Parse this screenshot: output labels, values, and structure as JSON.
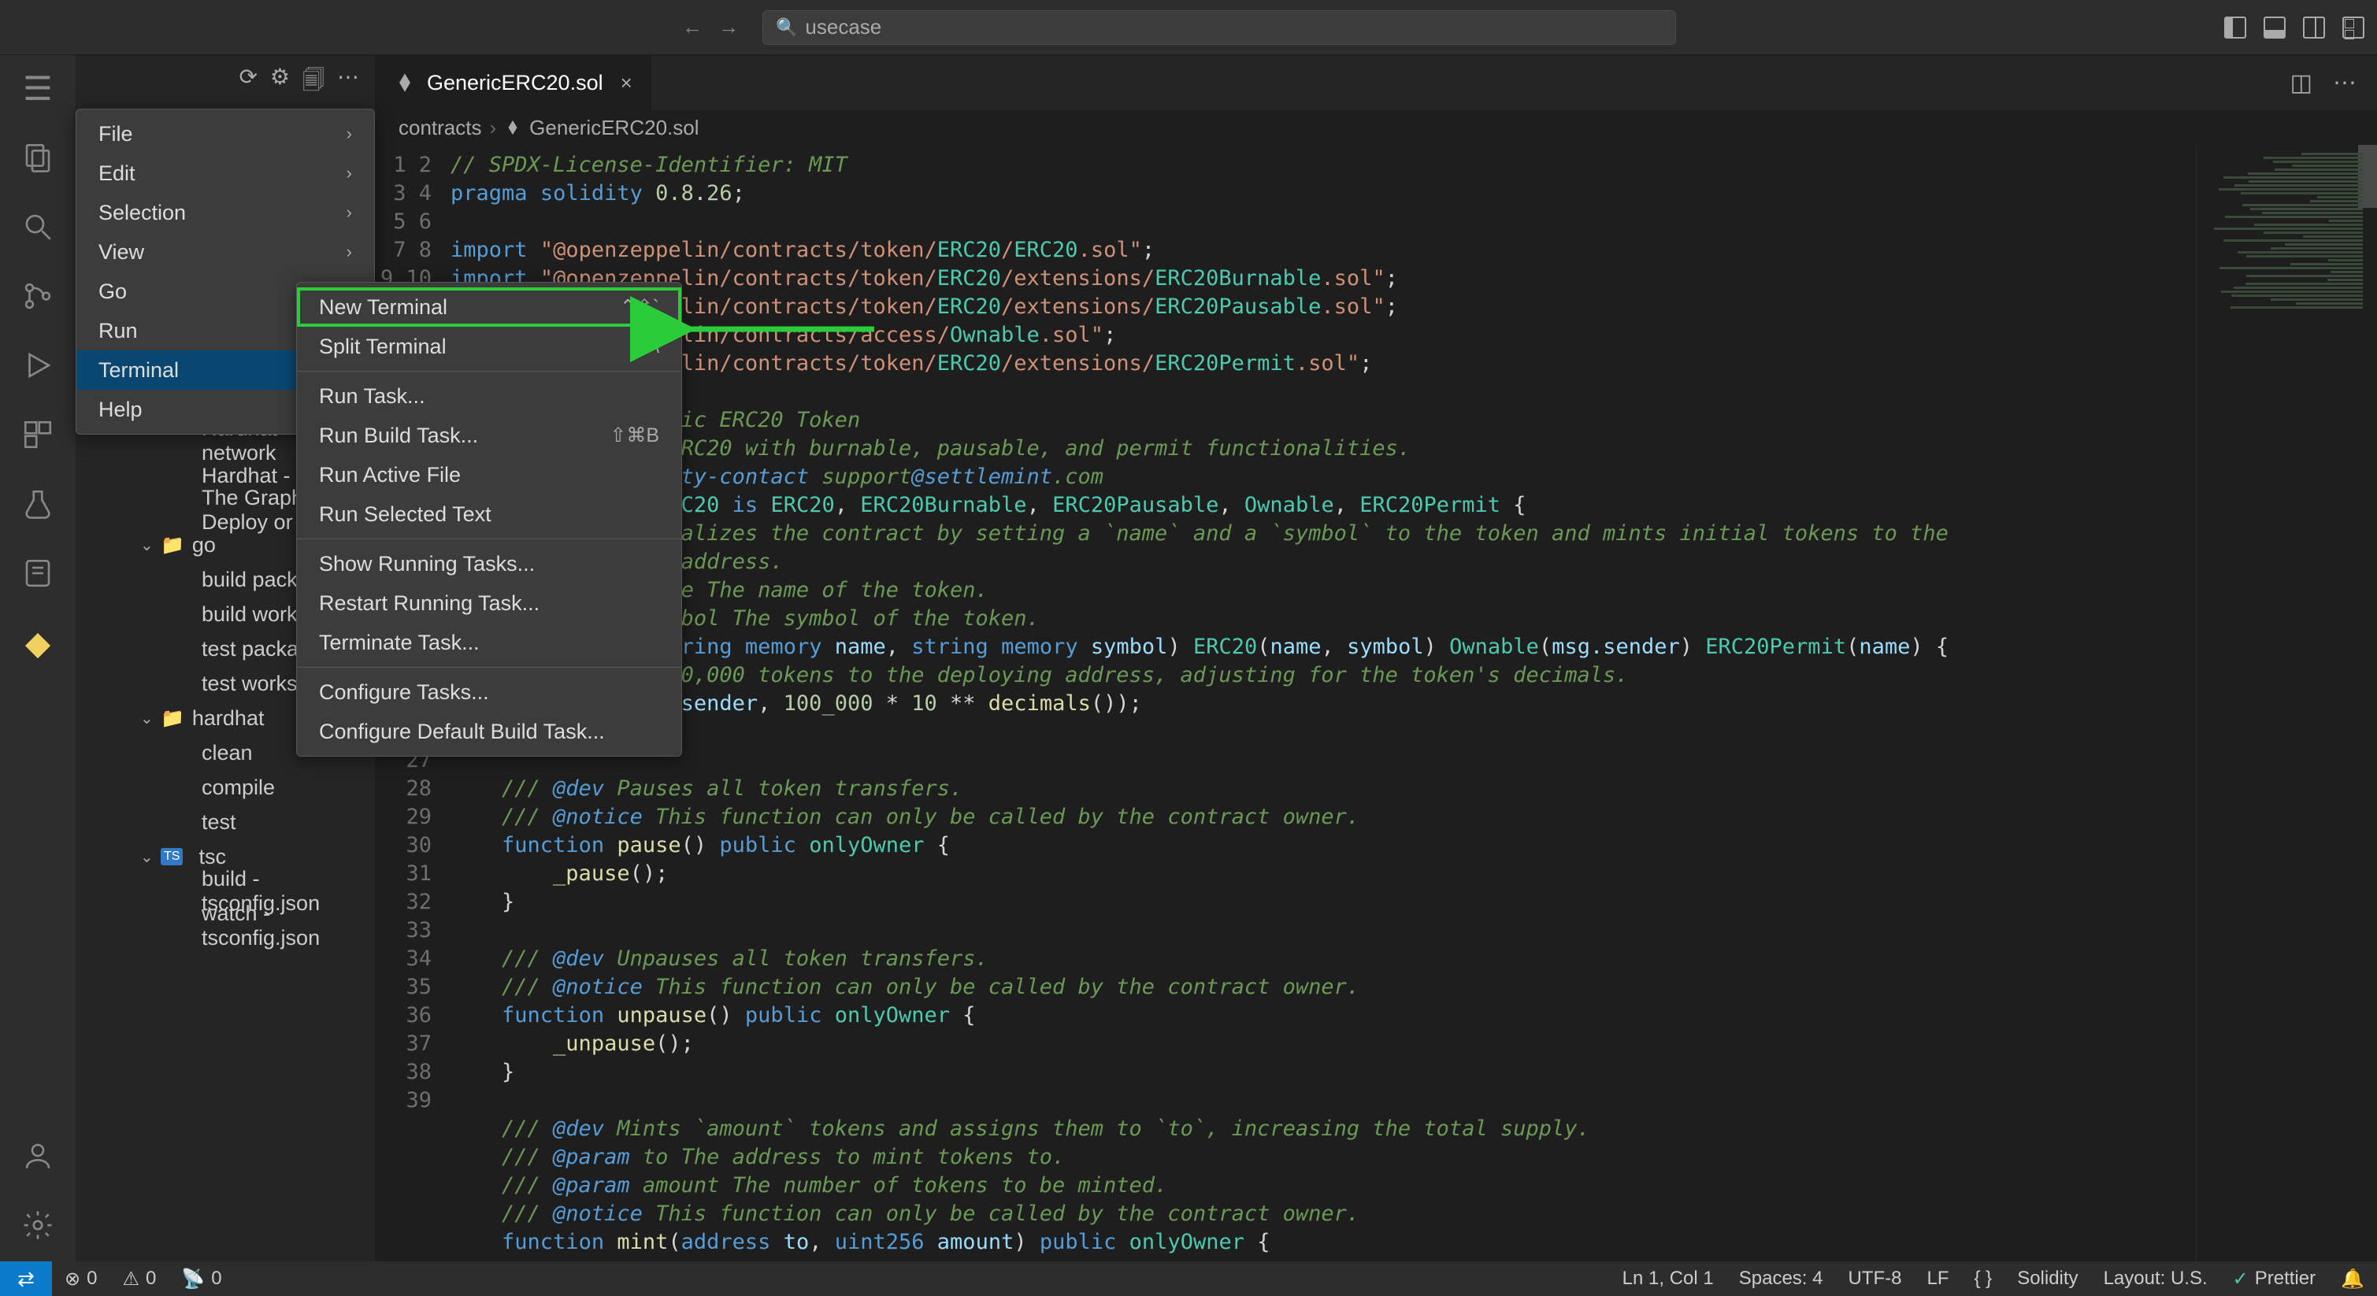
{
  "titlebar": {
    "search_text": "usecase"
  },
  "menu": {
    "items": [
      {
        "label": "File"
      },
      {
        "label": "Edit"
      },
      {
        "label": "Selection"
      },
      {
        "label": "View"
      },
      {
        "label": "Go"
      },
      {
        "label": "Run"
      },
      {
        "label": "Terminal"
      },
      {
        "label": "Help"
      }
    ]
  },
  "submenu": {
    "items": [
      {
        "label": "New Terminal",
        "shortcut": "⌃⇧`",
        "highlighted": true
      },
      {
        "label": "Split Terminal",
        "shortcut": "⌘\\"
      },
      {
        "sep": true
      },
      {
        "label": "Run Task..."
      },
      {
        "label": "Run Build Task...",
        "shortcut": "⇧⌘B"
      },
      {
        "label": "Run Active File"
      },
      {
        "label": "Run Selected Text"
      },
      {
        "sep": true
      },
      {
        "label": "Show Running Tasks..."
      },
      {
        "label": "Restart Running Task..."
      },
      {
        "label": "Terminate Task..."
      },
      {
        "sep": true
      },
      {
        "label": "Configure Tasks..."
      },
      {
        "label": "Configure Default Build Task..."
      }
    ]
  },
  "sidebar_tree": {
    "visible_partial": [
      {
        "label": "Hardhat - Start network",
        "type": "task"
      },
      {
        "label": "Hardhat - Test",
        "type": "task"
      },
      {
        "label": "The Graph - Deploy or u…",
        "type": "task"
      }
    ],
    "groups": [
      {
        "name": "go",
        "children": [
          {
            "label": "build package"
          },
          {
            "label": "build workspace"
          },
          {
            "label": "test package"
          },
          {
            "label": "test workspace"
          }
        ]
      },
      {
        "name": "hardhat",
        "children": [
          {
            "label": "clean"
          },
          {
            "label": "compile"
          },
          {
            "label": "test"
          }
        ]
      },
      {
        "name": "tsc",
        "icon": "ts",
        "children": [
          {
            "label": "build - tsconfig.json"
          },
          {
            "label": "watch - tsconfig.json"
          }
        ]
      }
    ]
  },
  "editor": {
    "tab_label": "GenericERC20.sol",
    "breadcrumb": [
      "contracts",
      "GenericERC20.sol"
    ],
    "code_lines": [
      "// SPDX-License-Identifier: MIT",
      "pragma solidity 0.8.26;",
      "",
      "import \"@openzeppelin/contracts/token/ERC20/ERC20.sol\";",
      "import \"@openzeppelin/contracts/token/ERC20/extensions/ERC20Burnable.sol\";",
      "import \"@openzeppelin/contracts/token/ERC20/extensions/ERC20Pausable.sol\";",
      "import \"@openzeppelin/contracts/access/Ownable.sol\";",
      "import \"@openzeppelin/contracts/token/ERC20/extensions/ERC20Permit.sol\";",
      "",
      "/// @title A generic ERC20 Token",
      "/// @dev Extends ERC20 with burnable, pausable, and permit functionalities.",
      "/// @custom:security-contact support@settlemint.com",
      "contract GenericERC20 is ERC20, ERC20Burnable, ERC20Pausable, Ownable, ERC20Permit {",
      "    /// @dev Initializes the contract by setting a `name` and a `symbol` to the token and mints initial tokens to the",
      "    /// deploying address.",
      "    /// @param name The name of the token.",
      "    /// @param symbol The symbol of the token.",
      "    constructor(string memory name, string memory symbol) ERC20(name, symbol) Ownable(msg.sender) ERC20Permit(name) {",
      "        // Mint 100,000 tokens to the deploying address, adjusting for the token's decimals.",
      "        _mint(msg.sender, 100_000 * 10 ** decimals());",
      "    }",
      "",
      "    /// @dev Pauses all token transfers.",
      "    /// @notice This function can only be called by the contract owner.",
      "    function pause() public onlyOwner {",
      "        _pause();",
      "    }",
      "",
      "    /// @dev Unpauses all token transfers.",
      "    /// @notice This function can only be called by the contract owner.",
      "    function unpause() public onlyOwner {",
      "        _unpause();",
      "    }",
      "",
      "    /// @dev Mints `amount` tokens and assigns them to `to`, increasing the total supply.",
      "    /// @param to The address to mint tokens to.",
      "    /// @param amount The number of tokens to be minted.",
      "    /// @notice This function can only be called by the contract owner.",
      "    function mint(address to, uint256 amount) public onlyOwner {"
    ]
  },
  "statusbar": {
    "errors": "0",
    "warnings": "0",
    "ports": "0",
    "position": "Ln 1, Col 1",
    "spaces": "Spaces: 4",
    "encoding": "UTF-8",
    "eol": "LF",
    "braces": "{ }",
    "lang": "Solidity",
    "layout": "Layout: U.S.",
    "prettier": "Prettier"
  }
}
